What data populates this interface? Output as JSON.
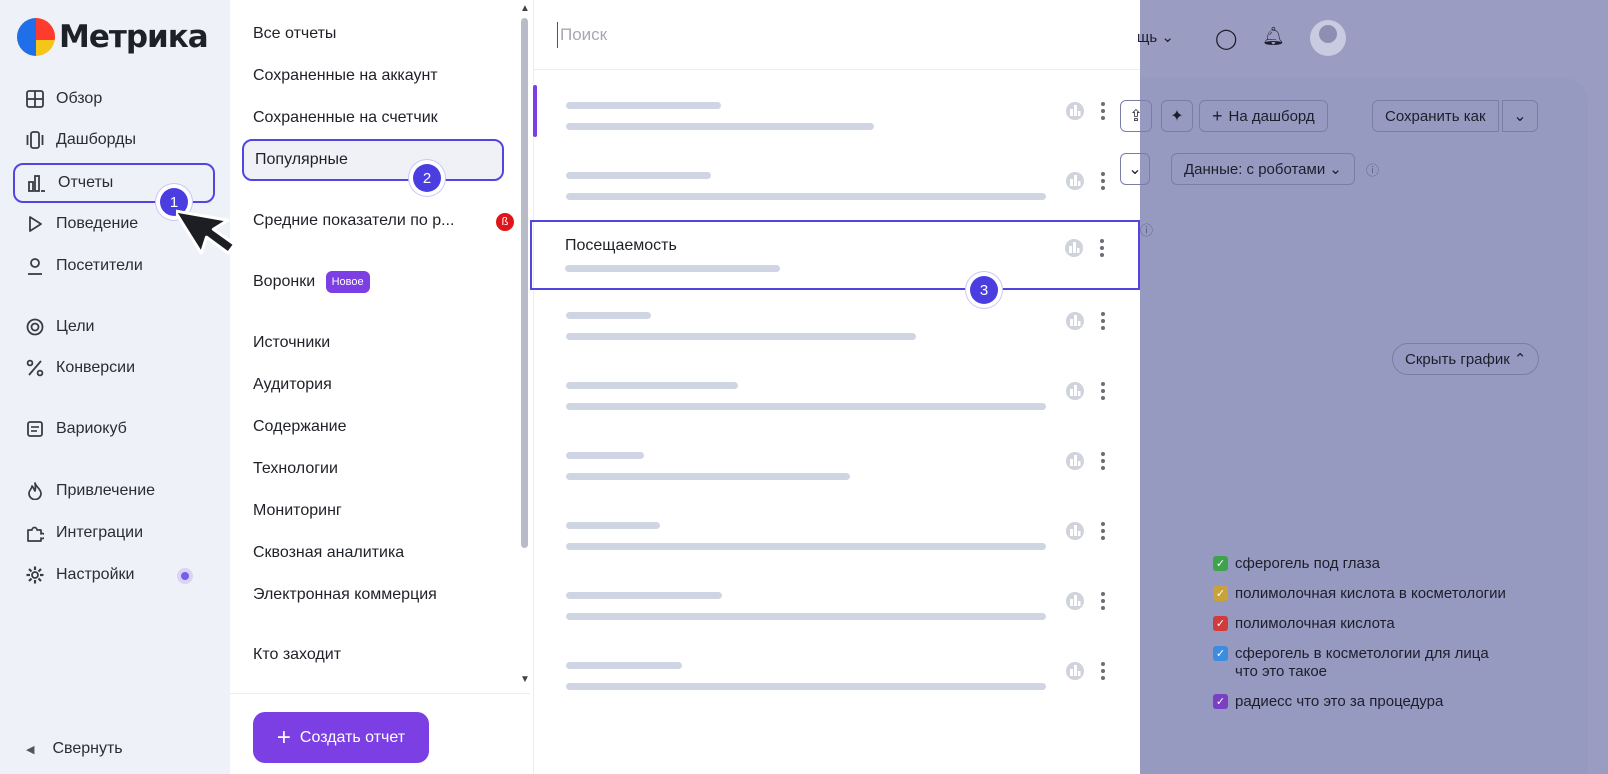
{
  "app": {
    "name": "Метрика"
  },
  "sidebar": {
    "items": [
      {
        "label": "Обзор",
        "icon": "grid-icon"
      },
      {
        "label": "Дашборды",
        "icon": "dashboards-icon"
      },
      {
        "label": "Отчеты",
        "icon": "bar-chart-icon",
        "active": true
      },
      {
        "label": "Поведение",
        "icon": "play-icon"
      },
      {
        "label": "Посетители",
        "icon": "person-icon"
      },
      {
        "label": "Цели",
        "icon": "target-icon"
      },
      {
        "label": "Конверсии",
        "icon": "percent-icon"
      },
      {
        "label": "Вариокуб",
        "icon": "table-icon"
      },
      {
        "label": "Привлечение",
        "icon": "flame-icon"
      },
      {
        "label": "Интеграции",
        "icon": "puzzle-icon"
      },
      {
        "label": "Настройки",
        "icon": "gear-icon"
      }
    ],
    "collapse_label": "Свернуть"
  },
  "categories": {
    "items": [
      "Все отчеты",
      "Сохраненные на аккаунт",
      "Сохраненные на счетчик",
      "Популярные",
      "Средние показатели по р...",
      "Воронки",
      "Источники",
      "Аудитория",
      "Содержание",
      "Технологии",
      "Мониторинг",
      "Сквозная аналитика",
      "Электронная коммерция",
      "Кто заходит"
    ],
    "selected": "Популярные",
    "beta_badge": "ß",
    "new_badge": "Новое",
    "create_button": "Создать отчет"
  },
  "reports": {
    "search_placeholder": "Поиск",
    "visible_title": "Посещаемость"
  },
  "background": {
    "help_fragment": "щь",
    "add_to_dashboard": "На дашборд",
    "save_as": "Сохранить как",
    "data_filter": "Данные: с роботами",
    "hide_chart": "Скрыть график",
    "legend": [
      {
        "label": "сферогель под глаза",
        "color": "#3fa34d"
      },
      {
        "label": "полимолочная кислота в косметологии",
        "color": "#c9a23a"
      },
      {
        "label": "полимолочная кислота",
        "color": "#d23b3b"
      },
      {
        "label": "сферогель в косметологии для лица что это такое",
        "color": "#3c8de0"
      },
      {
        "label": "радиесс что это за процедура",
        "color": "#7b3fc4"
      }
    ]
  },
  "steps": [
    "1",
    "2",
    "3"
  ],
  "colors": {
    "accent": "#5346e0",
    "button": "#7b3fe4",
    "overlay": "#9a9cc1"
  }
}
